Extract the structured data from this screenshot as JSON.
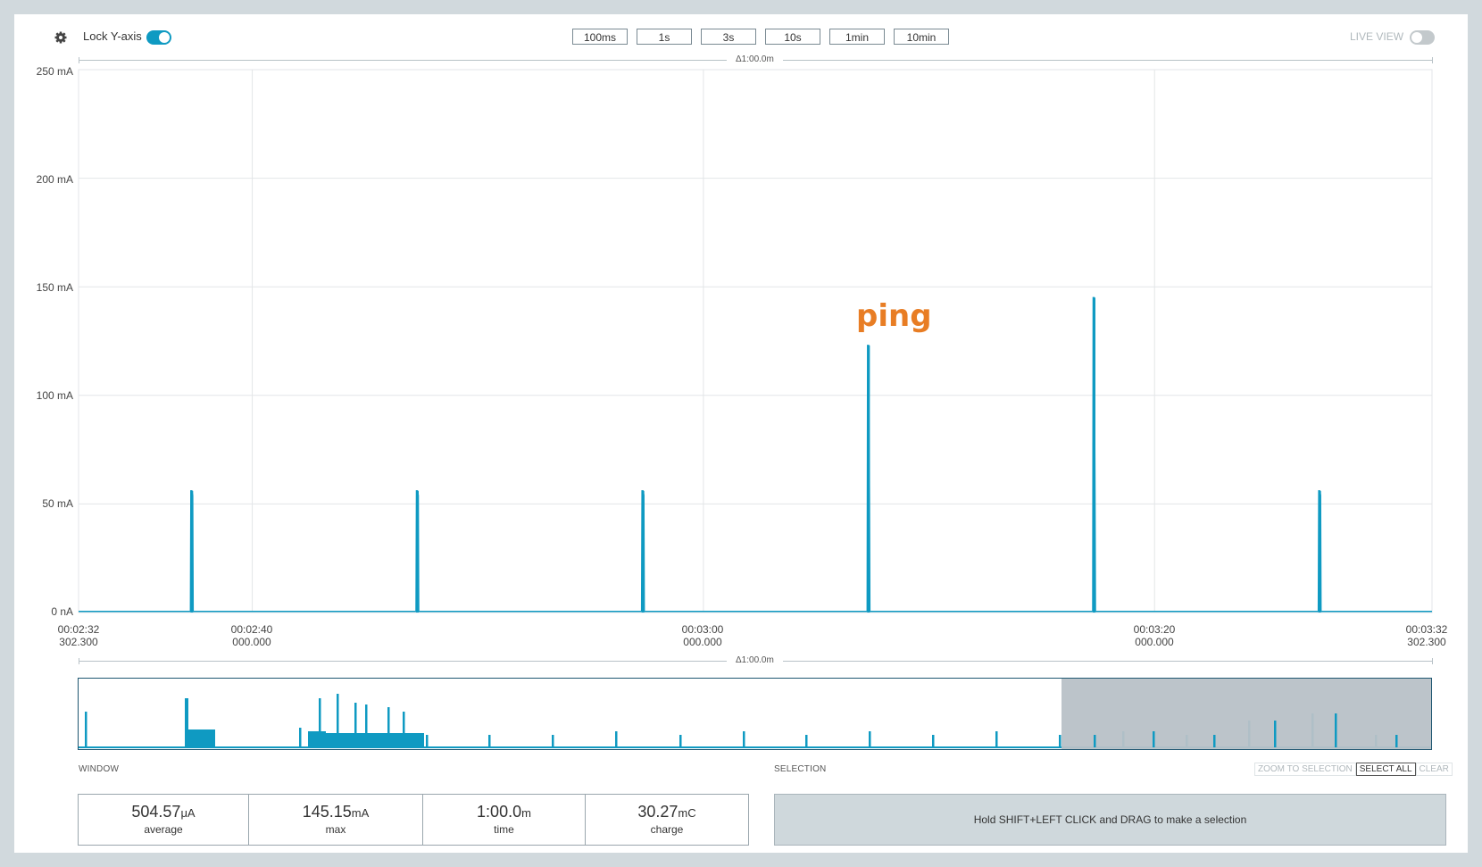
{
  "toolbar": {
    "lock_y_label": "Lock Y-axis",
    "lock_y_on": true,
    "zoom_buttons": [
      "100ms",
      "1s",
      "3s",
      "10s",
      "1min",
      "10min"
    ],
    "live_view_label": "LIVE VIEW",
    "live_view_on": false
  },
  "chart_header": {
    "delta": "Δ1:00.0m"
  },
  "chart_footer": {
    "delta": "Δ1:00.0m"
  },
  "annotation": {
    "text": "ping"
  },
  "colors": {
    "trace": "#0f9ac2",
    "accent": "#0f9ac2",
    "annotation": "#e87d24",
    "minimap_mask": "#b8c1c7"
  },
  "icons": {
    "settings": "gear-icon"
  },
  "chart_data": {
    "type": "line",
    "y_ticks": [
      "250 mA",
      "200 mA",
      "150 mA",
      "100 mA",
      "50 mA",
      "0 nA"
    ],
    "ylim": [
      0,
      250
    ],
    "yunit": "mA",
    "x_ticks": [
      {
        "time": "00:02:32",
        "sub": "302.300"
      },
      {
        "time": "00:02:40",
        "sub": "000.000"
      },
      {
        "time": "00:03:00",
        "sub": "000.000"
      },
      {
        "time": "00:03:20",
        "sub": "000.000"
      },
      {
        "time": "00:03:32",
        "sub": "302.300"
      }
    ],
    "xlim_seconds": [
      152.3,
      212.3
    ],
    "grid": true,
    "baseline_mA": 0.5,
    "spikes": [
      {
        "t": 157.3,
        "peak": 56
      },
      {
        "t": 167.3,
        "peak": 56
      },
      {
        "t": 177.3,
        "peak": 56
      },
      {
        "t": 187.3,
        "peak": 123
      },
      {
        "t": 197.3,
        "peak": 145
      },
      {
        "t": 207.3,
        "peak": 56
      }
    ]
  },
  "window_stats": {
    "title": "WINDOW",
    "average": {
      "value": "504.57",
      "unit": "μA",
      "label": "average"
    },
    "max": {
      "value": "145.15",
      "unit": "mA",
      "label": "max"
    },
    "time": {
      "value": "1:00.0",
      "unit": "m",
      "label": "time"
    },
    "charge": {
      "value": "30.27",
      "unit": "mC",
      "label": "charge"
    }
  },
  "selection": {
    "title": "SELECTION",
    "zoom_to_selection": "ZOOM TO SELECTION",
    "select_all": "SELECT ALL",
    "clear": "CLEAR",
    "hint": "Hold SHIFT+LEFT CLICK and DRAG to make a selection"
  }
}
